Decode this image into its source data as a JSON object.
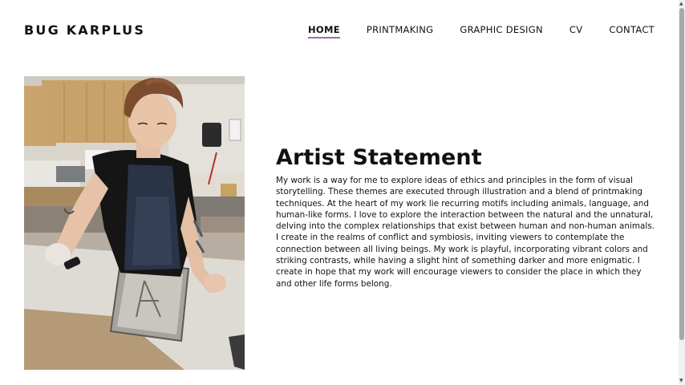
{
  "site": {
    "title": "BUG KARPLUS"
  },
  "nav": {
    "items": [
      {
        "label": "HOME",
        "active": true
      },
      {
        "label": "PRINTMAKING",
        "active": false
      },
      {
        "label": "GRAPHIC DESIGN",
        "active": false
      },
      {
        "label": "CV",
        "active": false
      },
      {
        "label": "CONTACT",
        "active": false
      }
    ],
    "active_underline_color": "#9a6cb0"
  },
  "main": {
    "heading": "Artist Statement",
    "body": "My work is a way for me to explore ideas of ethics and principles in the form of visual storytelling. These themes are executed through illustration and a blend of printmaking techniques. At the heart of my work lie recurring motifs including animals, language, and human-like forms. I love to explore the interaction between the natural and the unnatural, delving into the complex relationships that exist between human and non-human animals. I create in the realms of conflict and symbiosis, inviting viewers to contemplate the connection between all living beings. My work is playful, incorporating vibrant colors and striking contrasts, while having a slight hint of something darker and more enigmatic. I create in hope that my work will encourage viewers to consider the place in which they and other life forms belong."
  },
  "scrollbar": {
    "up_icon": "scroll-up-arrow-icon",
    "down_icon": "scroll-down-arrow-icon"
  }
}
